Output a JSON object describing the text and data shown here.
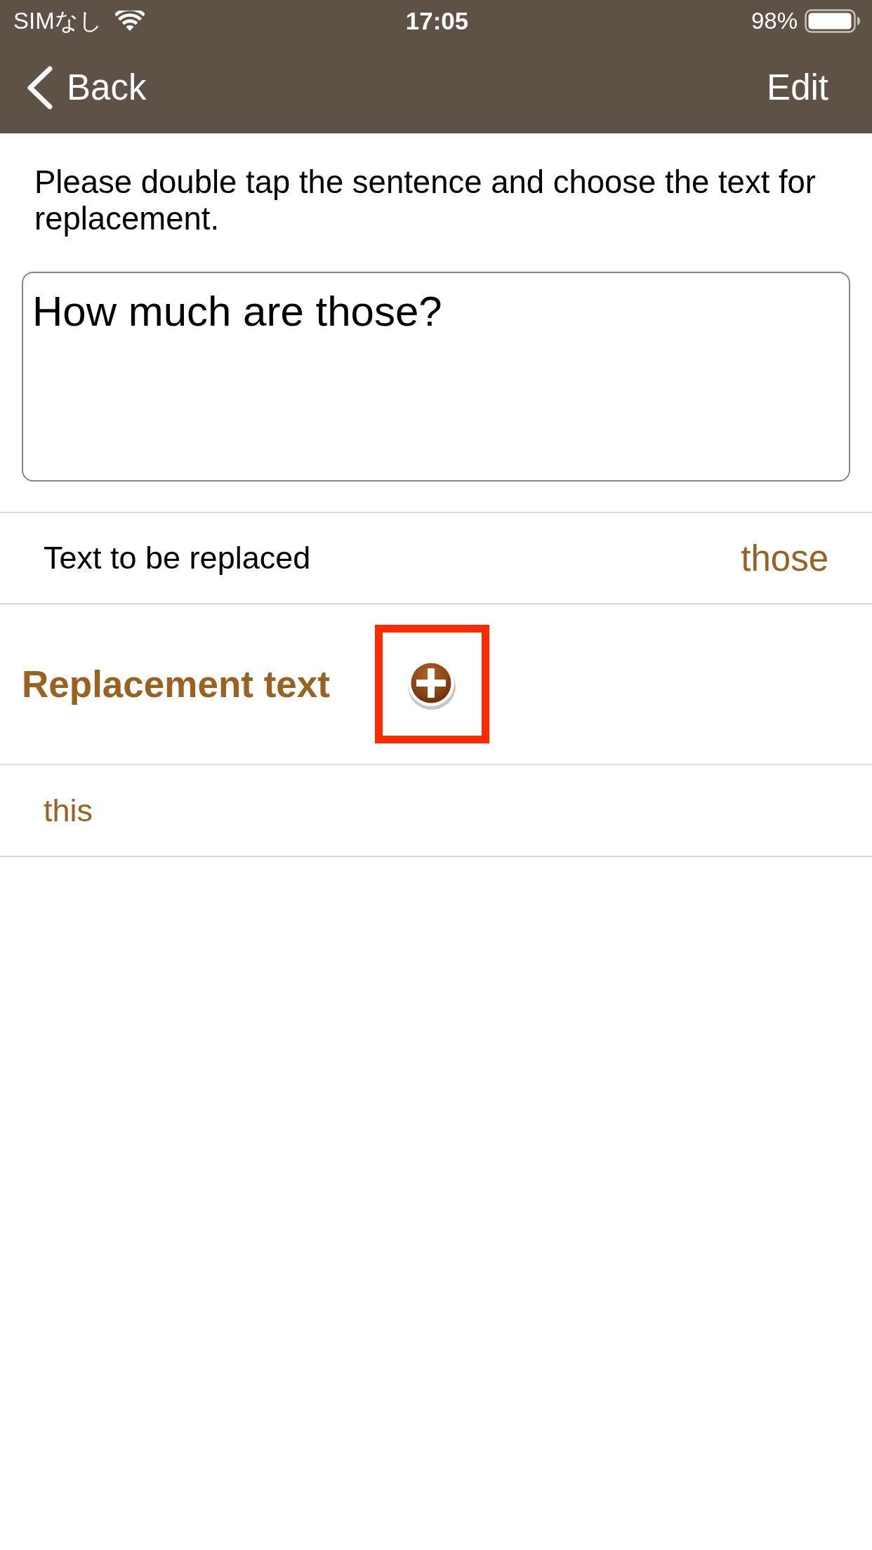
{
  "status_bar": {
    "carrier": "SIMなし",
    "time": "17:05",
    "battery": "98%"
  },
  "nav_bar": {
    "back": "Back",
    "edit": "Edit"
  },
  "instruction": "Please double tap the sentence and choose the text for replacement.",
  "sentence_field": {
    "value": "How much are those?"
  },
  "target_row": {
    "label": "Text to be replaced",
    "value": "those"
  },
  "replacement_section": {
    "title": "Replacement text",
    "add_button": {
      "highlighted": true
    }
  },
  "replacements": [
    {
      "text": "this"
    }
  ]
}
